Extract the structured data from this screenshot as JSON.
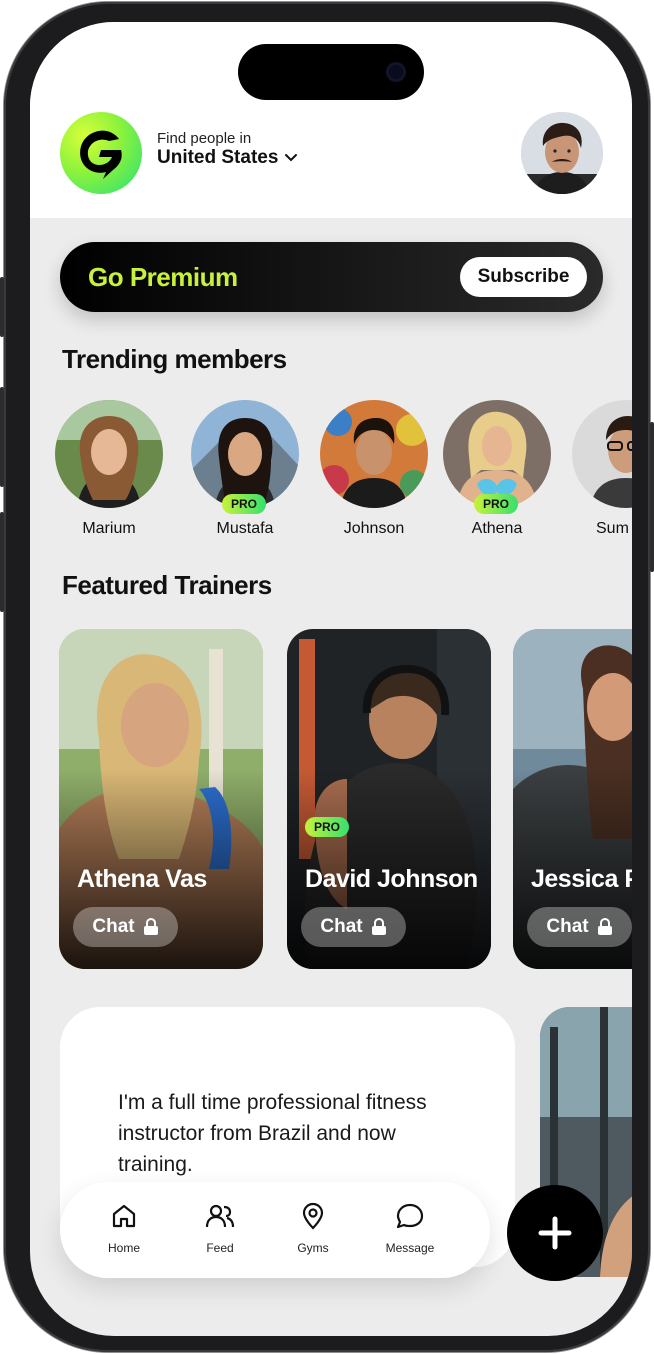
{
  "header": {
    "location_label": "Find people in",
    "location_value": "United States"
  },
  "premium": {
    "title": "Go Premium",
    "subscribe_label": "Subscribe"
  },
  "trending": {
    "title": "Trending members",
    "members": [
      {
        "name": "Marium",
        "pro": false
      },
      {
        "name": "Mustafa",
        "pro": true
      },
      {
        "name": "Johnson",
        "pro": false
      },
      {
        "name": "Athena",
        "pro": true
      },
      {
        "name": "Sum",
        "pro": false
      }
    ],
    "pro_label": "PRO"
  },
  "trainers": {
    "title": "Featured Trainers",
    "items": [
      {
        "name": "Athena Vas",
        "chat_label": "Chat",
        "pro": false
      },
      {
        "name": "David Johnson",
        "chat_label": "Chat",
        "pro": true
      },
      {
        "name": "Jessica Peterso",
        "chat_label": "Chat",
        "pro": false
      }
    ]
  },
  "bio": {
    "text": "I'm a full time professional fitness instructor from Brazil and now training."
  },
  "tabbar": {
    "tabs": [
      {
        "label": "Home",
        "icon": "home-icon"
      },
      {
        "label": "Feed",
        "icon": "users-icon"
      },
      {
        "label": "Gyms",
        "icon": "map-pin-icon"
      },
      {
        "label": "Message",
        "icon": "chat-bubble-icon"
      }
    ]
  },
  "colors": {
    "accent": "#c8f23a",
    "accent_green": "#35e06e",
    "dark": "#000000"
  }
}
